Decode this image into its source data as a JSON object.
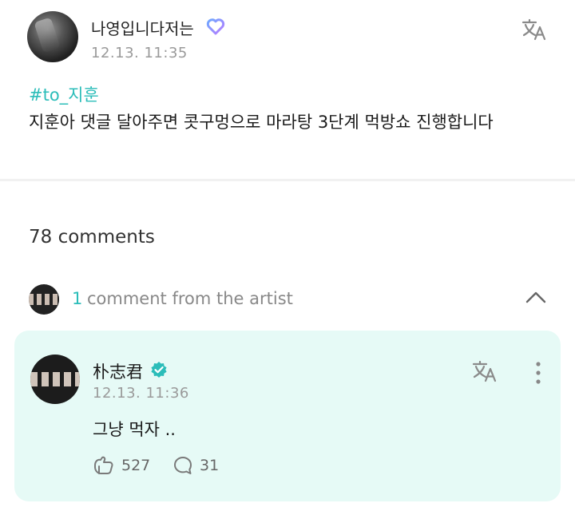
{
  "post": {
    "author_name": "나영입니다저는",
    "timestamp": "12.13. 11:35",
    "hashtag": "#to_지훈",
    "text": "지훈아 댓글 달아주면 콧구멍으로 마라탕 3단계 먹방쇼 진행합니다",
    "translate_icon": "translate-icon",
    "badge_icon": "heart-icon",
    "accent_color": "#2bbdb9"
  },
  "comments": {
    "count_label": "78 comments",
    "artist_section": {
      "count": "1",
      "label": "comment from the artist",
      "toggle_icon": "chevron-up-icon"
    },
    "artist_comment": {
      "name": "朴志君",
      "verified_icon": "verified-icon",
      "timestamp": "12.13. 11:36",
      "text": "그냥 먹자 ..",
      "likes": "527",
      "replies": "31",
      "card_color": "#e6faf6"
    }
  }
}
